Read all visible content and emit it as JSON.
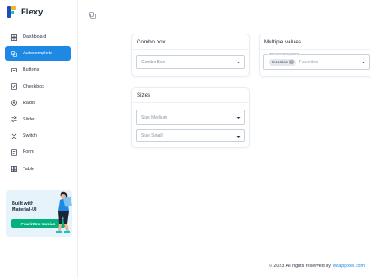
{
  "brand": {
    "name": "Flexy"
  },
  "sidebar": {
    "items": [
      {
        "label": "Dashboard",
        "icon": "grid-icon",
        "active": false
      },
      {
        "label": "Autocomplete",
        "icon": "layers-icon",
        "active": true
      },
      {
        "label": "Buttons",
        "icon": "buttons-icon",
        "active": false
      },
      {
        "label": "Checkbox",
        "icon": "checkbox-icon",
        "active": false
      },
      {
        "label": "Radio",
        "icon": "radio-icon",
        "active": false
      },
      {
        "label": "Slider",
        "icon": "slider-icon",
        "active": false
      },
      {
        "label": "Switch",
        "icon": "switch-icon",
        "active": false
      },
      {
        "label": "Form",
        "icon": "form-icon",
        "active": false
      },
      {
        "label": "Table",
        "icon": "table-icon",
        "active": false
      }
    ]
  },
  "promo": {
    "line1": "Built with",
    "line2": "Material-UI",
    "button": "Check Pro Version"
  },
  "cards": {
    "combo": {
      "title": "Combo box",
      "placeholder": "Combo Box"
    },
    "multiple": {
      "title": "Multiple values",
      "field_label": "filterSelectedOptions",
      "chip": "Inception",
      "placeholder": "Favorites"
    },
    "sizes": {
      "title": "Sizes",
      "medium": "Size Medium",
      "small": "Size Small"
    }
  },
  "footer": {
    "text": "© 2023 All rights reserved by ",
    "link": "Wrappixel.com"
  },
  "colors": {
    "accent": "#1e88e5",
    "promo_button": "#02b17b"
  }
}
